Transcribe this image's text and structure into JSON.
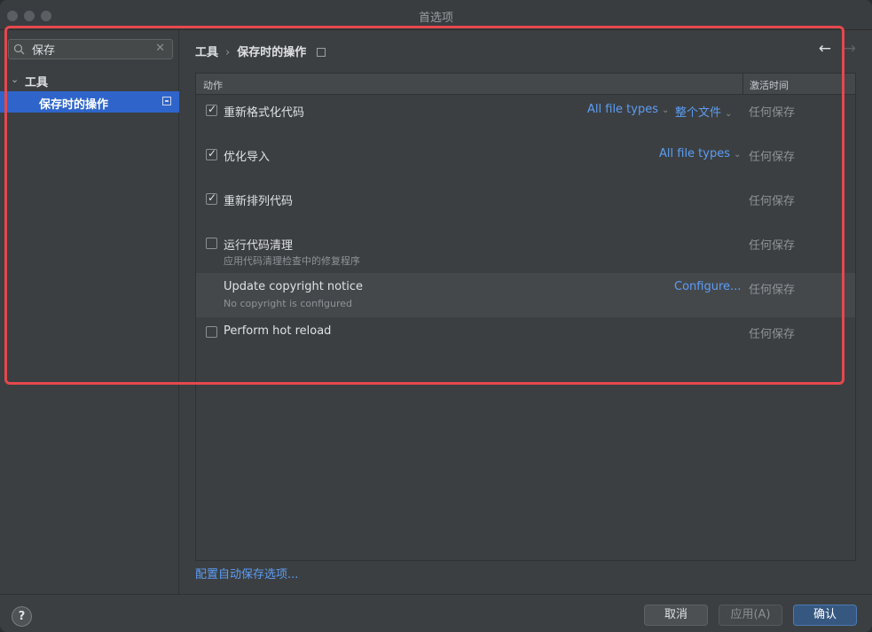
{
  "window": {
    "title": "首选项"
  },
  "sidebar": {
    "search": {
      "value": "保存",
      "clear": "✕"
    },
    "tree": {
      "parent_label": "工具",
      "child_label": "保存时的操作"
    }
  },
  "main": {
    "breadcrumb": {
      "parent": "工具",
      "separator": "›",
      "current": "保存时的操作"
    },
    "nav": {
      "back": "←",
      "forward": "→"
    },
    "table": {
      "headers": {
        "action": "动作",
        "activation": "激活时间"
      },
      "rows": [
        {
          "label": "重新格式化代码",
          "sub": "",
          "checked": true,
          "links": [
            "All file types",
            "整个文件"
          ],
          "when": "任何保存"
        },
        {
          "label": "优化导入",
          "sub": "",
          "checked": true,
          "links": [
            "All file types"
          ],
          "when": "任何保存"
        },
        {
          "label": "重新排列代码",
          "sub": "",
          "checked": true,
          "links": [],
          "when": "任何保存"
        },
        {
          "label": "运行代码清理",
          "sub": "应用代码清理检查中的修复程序",
          "checked": false,
          "links": [],
          "when": "任何保存"
        },
        {
          "label": "Update copyright notice",
          "sub": "No copyright is configured",
          "checked": null,
          "links": [
            "Configure..."
          ],
          "when": "任何保存"
        },
        {
          "label": "Perform hot reload",
          "sub": "",
          "checked": false,
          "links": [],
          "when": "任何保存"
        }
      ]
    },
    "footer_link": "配置自动保存选项..."
  },
  "bottombar": {
    "help": "?",
    "cancel": "取消",
    "apply": "应用(A)",
    "ok": "确认"
  },
  "colors": {
    "accent": "#2f65ca",
    "link": "#5c9df5",
    "highlight": "#e5484d",
    "ok_button": "#365880"
  }
}
